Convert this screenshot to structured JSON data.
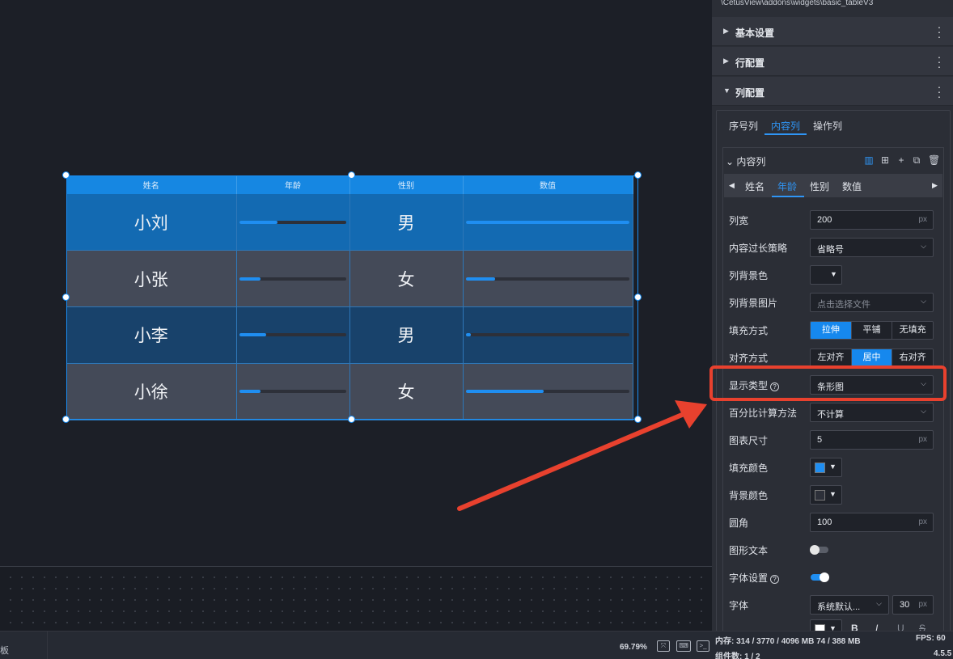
{
  "panel": {
    "path": "\\CetusView\\addons\\widgets\\basic_tableV3",
    "sections": [
      {
        "label": "基本设置"
      },
      {
        "label": "行配置"
      },
      {
        "label": "列配置"
      }
    ],
    "column_tabs": [
      "序号列",
      "内容列",
      "操作列"
    ],
    "content_column_title": "内容列",
    "column_names": [
      "姓名",
      "年龄",
      "性别",
      "数值"
    ],
    "fields": {
      "width_label": "列宽",
      "width_value": "200",
      "width_unit": "px",
      "overflow_label": "内容过长策略",
      "overflow_value": "省略号",
      "bg_color_label": "列背景色",
      "bg_image_label": "列背景图片",
      "bg_image_placeholder": "点击选择文件",
      "fill_mode_label": "填充方式",
      "fill_modes": [
        "拉伸",
        "平铺",
        "无填充"
      ],
      "align_label": "对齐方式",
      "align_modes": [
        "左对齐",
        "居中",
        "右对齐"
      ],
      "display_type_label": "显示类型",
      "display_type_value": "条形图",
      "percent_label": "百分比计算方法",
      "percent_value": "不计算",
      "chart_size_label": "图表尺寸",
      "chart_size_value": "5",
      "chart_size_unit": "px",
      "fill_color_label": "填充颜色",
      "fill_color": "#1f8ef1",
      "background_color_label": "背景颜色",
      "background_color": "#2d3039",
      "radius_label": "圆角",
      "radius_value": "100",
      "radius_unit": "px",
      "shape_text_label": "图形文本",
      "shape_text_on": false,
      "font_settings_label": "字体设置",
      "font_settings_on": true,
      "font_label": "字体",
      "font_value": "系统默认...",
      "font_size_value": "30",
      "font_size_unit": "px",
      "style_buttons": [
        "B",
        "I",
        "U",
        "S"
      ]
    }
  },
  "table": {
    "headers": [
      "姓名",
      "年龄",
      "性别",
      "数值"
    ],
    "rows": [
      {
        "name": "小刘",
        "age_bar": 0.36,
        "gender": "男",
        "value_bar": 1.0
      },
      {
        "name": "小张",
        "age_bar": 0.2,
        "gender": "女",
        "value_bar": 0.18
      },
      {
        "name": "小李",
        "age_bar": 0.25,
        "gender": "男",
        "value_bar": 0.03
      },
      {
        "name": "小徐",
        "age_bar": 0.2,
        "gender": "女",
        "value_bar": 0.48
      }
    ]
  },
  "status": {
    "left_label": "板",
    "zoom": "69.79%",
    "memory": "内存: 314 / 3770 / 4096 MB 74 / 388 MB",
    "fps": "FPS: 60",
    "components": "组件数: 1 / 2",
    "version": "4.5.5"
  }
}
